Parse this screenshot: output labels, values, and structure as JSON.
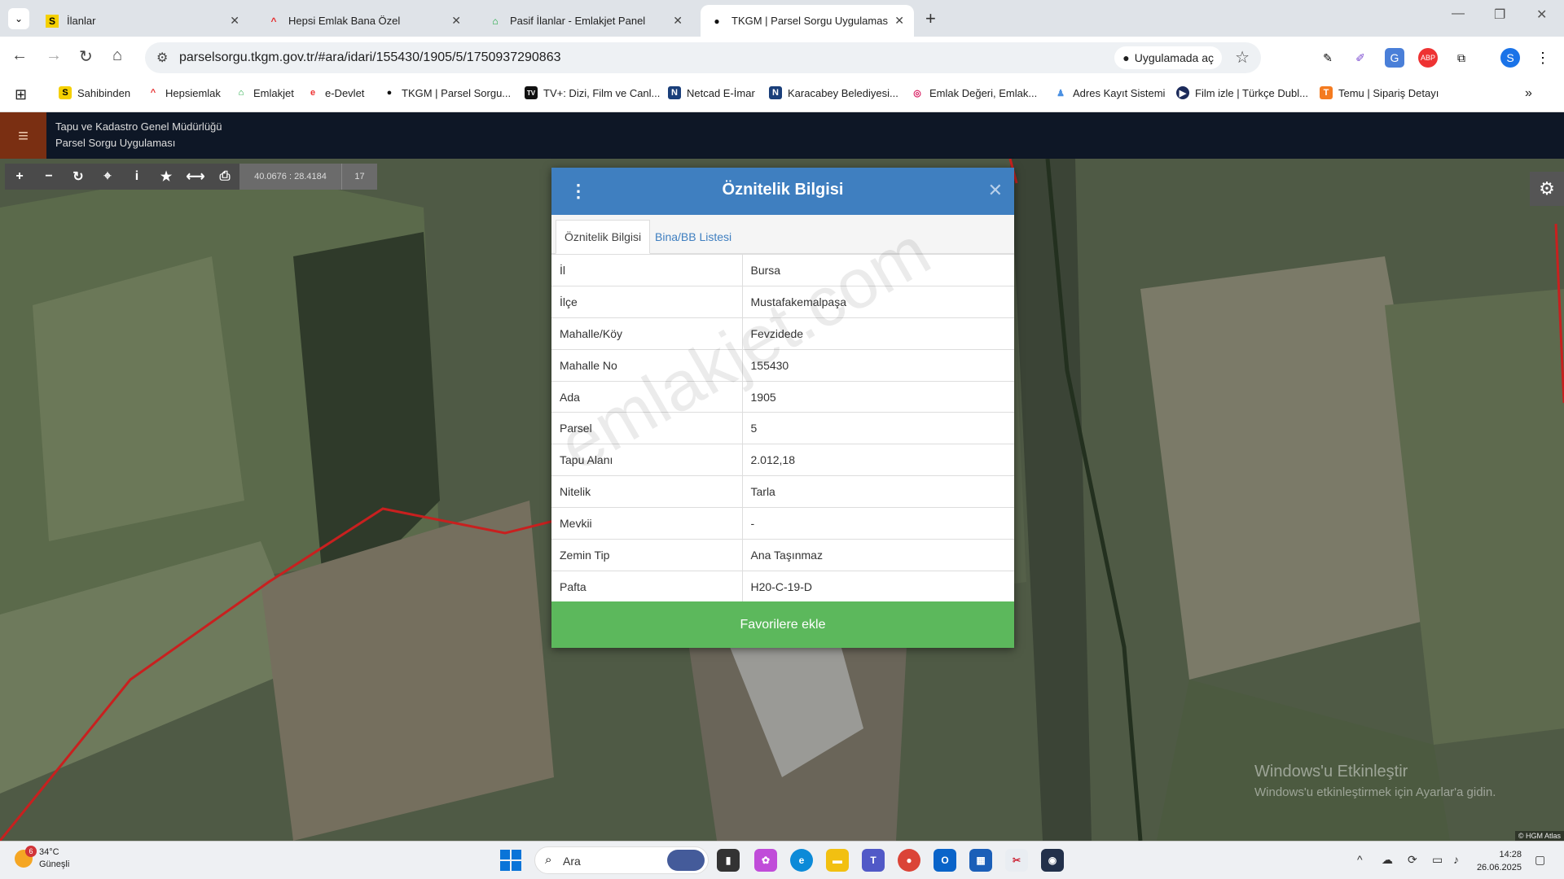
{
  "browser": {
    "tabs": [
      {
        "title": "İlanlar",
        "favicon": "S",
        "active": false
      },
      {
        "title": "Hepsi Emlak Bana Özel",
        "favicon": "hepsiemlak-logo",
        "active": false
      },
      {
        "title": "Pasif İlanlar - Emlakjet Panel",
        "favicon": "emlakjet-logo",
        "active": false
      },
      {
        "title": "TKGM | Parsel Sorgu Uygulaması",
        "favicon": "location-pin-icon",
        "active": true
      }
    ],
    "url": "parselsorgu.tkgm.gov.tr/#ara/idari/155430/1905/5/1750937290863",
    "open_in_app": "Uygulamada aç",
    "profile_initial": "S",
    "adblock_label": "ABP",
    "bookmarks": [
      {
        "label": "Sahibinden",
        "icon": "S",
        "color": "#f5d000",
        "text_color": "#000"
      },
      {
        "label": "Hepsiemlak",
        "icon": "^",
        "color": "#fff",
        "text_color": "#e62a2a"
      },
      {
        "label": "Emlakjet",
        "icon": "⌂",
        "color": "#fff",
        "text_color": "#13a538"
      },
      {
        "label": "e-Devlet",
        "icon": "e",
        "color": "#fff",
        "text_color": "#e33"
      },
      {
        "label": "TKGM | Parsel Sorgu...",
        "icon": "●",
        "color": "#fff",
        "text_color": "#111"
      },
      {
        "label": "TV+: Dizi, Film ve Canl...",
        "icon": "TV",
        "color": "#111",
        "text_color": "#fff"
      },
      {
        "label": "Netcad E-İmar",
        "icon": "N",
        "color": "#1a3f7a",
        "text_color": "#fff"
      },
      {
        "label": "Karacabey Belediyesi...",
        "icon": "N",
        "color": "#1a3f7a",
        "text_color": "#fff"
      },
      {
        "label": "Emlak Değeri, Emlak...",
        "icon": "◎",
        "color": "#fff",
        "text_color": "#d81b60"
      },
      {
        "label": "Adres Kayıt Sistemi",
        "icon": "♟",
        "color": "#fff",
        "text_color": "#4a90e2"
      },
      {
        "label": "Film izle | Türkçe Dubl...",
        "icon": "▶",
        "color": "#1b2a5a",
        "text_color": "#fff"
      },
      {
        "label": "Temu | Sipariş Detayı",
        "icon": "T",
        "color": "#f47b20",
        "text_color": "#fff"
      }
    ]
  },
  "app": {
    "org": "Tapu ve Kadastro Genel Müdürlüğü",
    "name": "Parsel Sorgu Uygulaması",
    "coordinates": "40.0676 : 28.4184",
    "zoom_level": "17",
    "attribution": "© HGM Atlas"
  },
  "modal": {
    "title": "Öznitelik Bilgisi",
    "tabs": [
      "Öznitelik Bilgisi",
      "Bina/BB Listesi"
    ],
    "rows": [
      {
        "key": "İl",
        "value": "Bursa"
      },
      {
        "key": "İlçe",
        "value": "Mustafakemalpaşa"
      },
      {
        "key": "Mahalle/Köy",
        "value": "Fevzidede"
      },
      {
        "key": "Mahalle No",
        "value": "155430"
      },
      {
        "key": "Ada",
        "value": "1905"
      },
      {
        "key": "Parsel",
        "value": "5"
      },
      {
        "key": "Tapu Alanı",
        "value": "2.012,18"
      },
      {
        "key": "Nitelik",
        "value": "Tarla"
      },
      {
        "key": "Mevkii",
        "value": "-"
      },
      {
        "key": "Zemin Tip",
        "value": "Ana Taşınmaz"
      },
      {
        "key": "Pafta",
        "value": "H20-C-19-D"
      }
    ],
    "add_favorite": "Favorilere ekle",
    "watermark": "emlakjet.com"
  },
  "windows_activation": {
    "line1": "Windows'u Etkinleştir",
    "line2": "Windows'u etkinleştirmek için Ayarlar'a gidin."
  },
  "taskbar": {
    "weather_badge": "6",
    "temperature": "34°C",
    "condition": "Güneşli",
    "search_placeholder": "Ara",
    "time": "14:28",
    "date": "26.06.2025"
  },
  "colors": {
    "modal_header": "#3f7fc0",
    "favorite_button": "#5cb85c",
    "app_header": "#0e1726",
    "parcel_line": "#c8201f"
  }
}
